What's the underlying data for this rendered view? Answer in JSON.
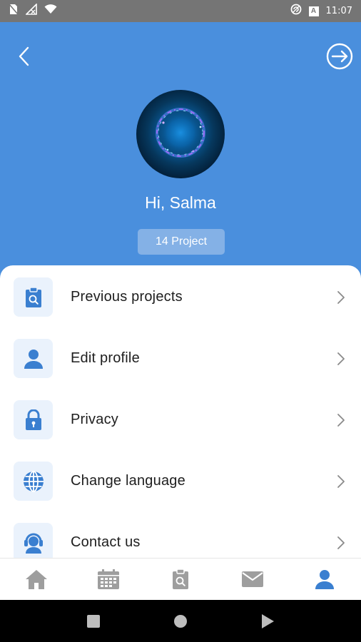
{
  "status_bar": {
    "time": "11:07",
    "keyboard_badge": "A",
    "icons_left": [
      "no-sim-icon",
      "signal-off-icon",
      "wifi-icon"
    ],
    "icons_right": [
      "sync-icon",
      "keyboard-badge-icon"
    ]
  },
  "header": {
    "greeting": "Hi, Salma",
    "project_count": "14 Project",
    "background_color": "#4A8FDD",
    "pill_color": "#84B1E6"
  },
  "menu": {
    "items": [
      {
        "label": "Previous projects",
        "icon": "clipboard-search-icon"
      },
      {
        "label": "Edit profile",
        "icon": "person-icon"
      },
      {
        "label": "Privacy",
        "icon": "lock-icon"
      },
      {
        "label": "Change language",
        "icon": "globe-icon"
      },
      {
        "label": "Contact us",
        "icon": "headset-icon"
      }
    ],
    "accent_color": "#3A7FD0",
    "icon_bg_color": "#EAF2FC"
  },
  "bottom_nav": {
    "tabs": [
      {
        "icon": "home-icon",
        "active": false
      },
      {
        "icon": "calendar-icon",
        "active": false
      },
      {
        "icon": "clipboard-search-icon",
        "active": false
      },
      {
        "icon": "mail-icon",
        "active": false
      },
      {
        "icon": "person-icon",
        "active": true
      }
    ],
    "active_color": "#3A7FD0",
    "inactive_color": "#9E9E9E"
  },
  "system_nav": {
    "buttons": [
      "recents-square-icon",
      "home-circle-icon",
      "back-triangle-icon"
    ]
  }
}
